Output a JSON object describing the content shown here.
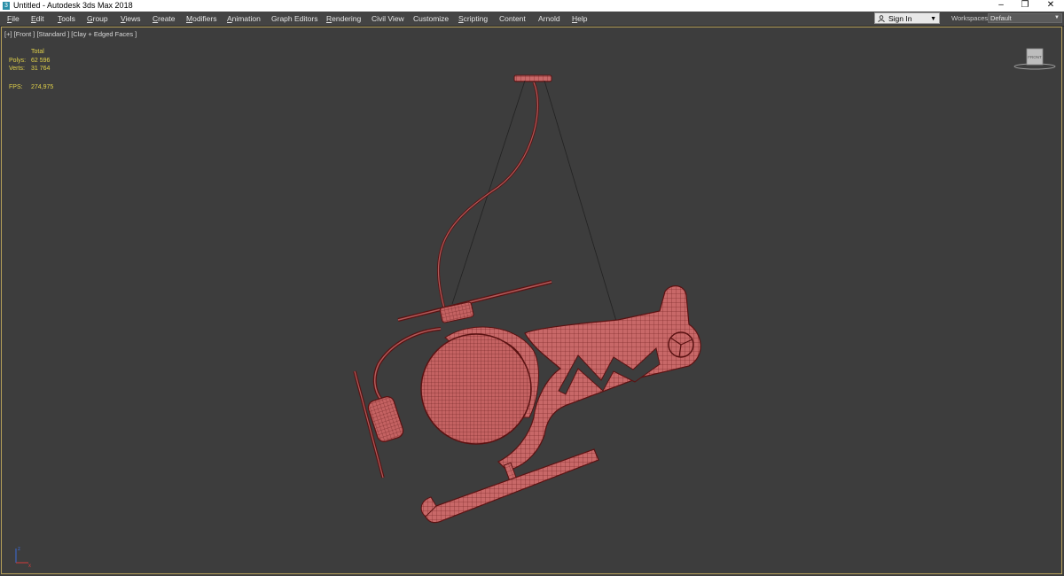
{
  "window": {
    "title": "Untitled - Autodesk 3ds Max 2018",
    "minimize_glyph": "–",
    "restore_glyph": "❐",
    "close_glyph": "✕"
  },
  "menu": {
    "items": [
      {
        "underline": "F",
        "rest": "ile"
      },
      {
        "underline": "E",
        "rest": "dit"
      },
      {
        "underline": "T",
        "rest": "ools"
      },
      {
        "underline": "G",
        "rest": "roup"
      },
      {
        "underline": "V",
        "rest": "iews"
      },
      {
        "underline": "C",
        "rest": "reate"
      },
      {
        "underline": "M",
        "rest": "odifiers"
      },
      {
        "underline": "A",
        "rest": "nimation"
      },
      {
        "underline": "",
        "rest": "Graph Editors"
      },
      {
        "underline": "R",
        "rest": "endering"
      },
      {
        "underline": "",
        "rest": "Civil View"
      },
      {
        "underline": "",
        "rest": "Customize"
      },
      {
        "underline": "S",
        "rest": "cripting"
      },
      {
        "underline": "",
        "rest": "Content"
      },
      {
        "underline": "",
        "rest": "Arnold"
      },
      {
        "underline": "H",
        "rest": "elp"
      }
    ]
  },
  "account": {
    "sign_in_label": "Sign In",
    "icon": "user-icon"
  },
  "workspaces": {
    "label": "Workspaces:",
    "value": "Default"
  },
  "viewport": {
    "label": "[+] [Front ] [Standard ] [Clay + Edged Faces ]",
    "stats": {
      "header": "Total",
      "polys_label": "Polys:",
      "polys_value": "62 596",
      "verts_label": "Verts:",
      "verts_value": "31 764",
      "fps_label": "FPS:",
      "fps_value": "274,975"
    },
    "viewcube_label": "FRONT",
    "axis_labels": {
      "z": "z",
      "x": "x"
    }
  },
  "colors": {
    "model_fill": "#c86868",
    "model_edge": "#5a1212",
    "stats_text": "#e2d24a",
    "viewport_border": "#b8a15a"
  }
}
